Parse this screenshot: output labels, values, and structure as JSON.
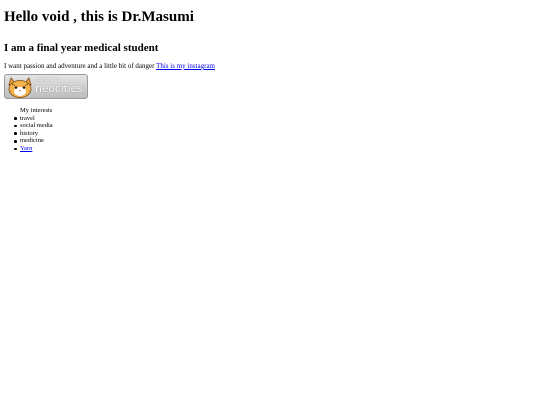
{
  "heading": "Hello void , this is Dr.Masumi",
  "subheading": "I am a final year medical student",
  "tagline": {
    "text": "I want passion and adventure and a little bit of danger",
    "link_label": "This is my instagram"
  },
  "badge": {
    "line1": "hosted by",
    "line2": "neocities"
  },
  "interests": {
    "label": "My interests",
    "items": [
      "travel",
      "social media",
      "history",
      "medicine"
    ],
    "link_item": "Yarn"
  }
}
